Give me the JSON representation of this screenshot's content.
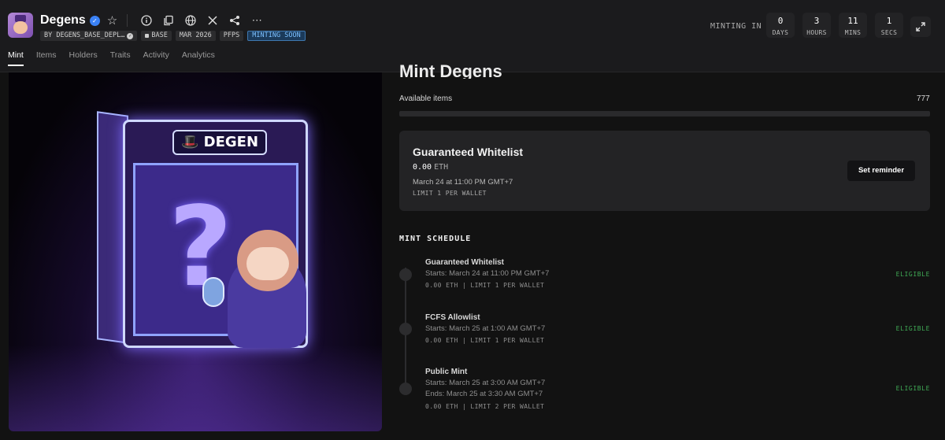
{
  "header": {
    "title": "Degens",
    "badges": {
      "creator": "BY DEGENS_BASE_DEPL…",
      "chain": "BASE",
      "date": "MAR 2026",
      "category": "PFPS",
      "status": "MINTING SOON"
    },
    "icons": [
      "verified-icon",
      "star-icon",
      "info-icon",
      "copy-icon",
      "globe-icon",
      "x-icon",
      "share-icon",
      "more-icon"
    ],
    "countdown": {
      "label": "MINTING IN",
      "days": "0",
      "days_label": "DAYS",
      "hours": "3",
      "hours_label": "HOURS",
      "mins": "11",
      "mins_label": "MINS",
      "secs": "1",
      "secs_label": "SECS"
    }
  },
  "tabs": [
    "Mint",
    "Items",
    "Holders",
    "Traits",
    "Activity",
    "Analytics"
  ],
  "artwork": {
    "sign": "DEGEN",
    "glyph": "?"
  },
  "mint": {
    "title": "Mint Degens",
    "available_label": "Available items",
    "available_value": "777",
    "progress_fraction": 0
  },
  "active_card": {
    "title": "Guaranteed Whitelist",
    "price": "0.00",
    "currency": "ETH",
    "date": "March 24 at 11:00 PM GMT+7",
    "limit": "LIMIT 1 PER WALLET",
    "button": "Set reminder"
  },
  "schedule": {
    "title": "MINT SCHEDULE",
    "stages": [
      {
        "name": "Guaranteed Whitelist",
        "line1": "Starts: March 24 at 11:00 PM GMT+7",
        "line2": "",
        "meta": "0.00 ETH | LIMIT 1 PER WALLET",
        "status": "ELIGIBLE"
      },
      {
        "name": "FCFS Allowlist",
        "line1": "Starts: March 25 at 1:00 AM GMT+7",
        "line2": "",
        "meta": "0.00 ETH | LIMIT 1 PER WALLET",
        "status": "ELIGIBLE"
      },
      {
        "name": "Public Mint",
        "line1": "Starts: March 25 at 3:00 AM GMT+7",
        "line2": "Ends: March 25 at 3:30 AM GMT+7",
        "meta": "0.00 ETH | LIMIT 2 PER WALLET",
        "status": "ELIGIBLE"
      }
    ]
  },
  "colors": {
    "background": "#121212",
    "header_bg": "#1b1b1d",
    "card_bg": "#232325",
    "eligible": "#3faa55",
    "minting_soon": "#7cc0ff"
  }
}
